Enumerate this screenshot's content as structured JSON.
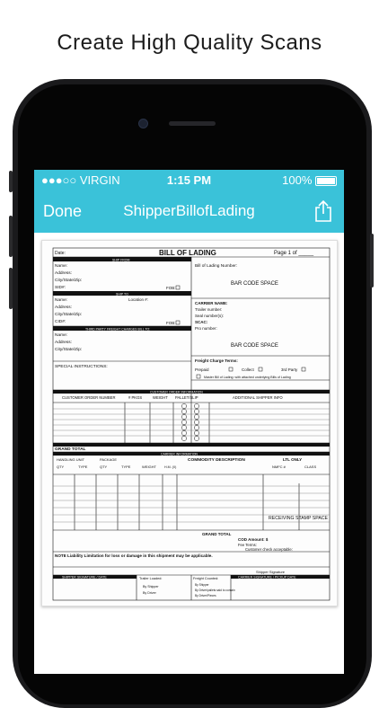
{
  "headline": "Create High Quality Scans",
  "status": {
    "carrier": "●●●○○ VIRGIN",
    "time": "1:15 PM",
    "battery": "100%"
  },
  "nav": {
    "done": "Done",
    "title": "ShipperBillofLading",
    "share_icon": "share-icon"
  },
  "accent": "#3ac2d9",
  "form": {
    "date": "Date:",
    "title": "BILL OF LADING",
    "page": "Page 1 of _____",
    "ship_from": "SHIP FROM",
    "ship_to": "SHIP TO",
    "third_party": "THIRD PARTY FREIGHT CHARGES BILL TO:",
    "name": "Name:",
    "address": "Address:",
    "city": "City/State/Zip:",
    "sid": "SID#:",
    "cid": "CID#:",
    "fob": "FOB:",
    "location": "Location #:",
    "special": "SPECIAL INSTRUCTIONS:",
    "bol_number": "Bill of Lading Number:",
    "barcode": "BAR CODE SPACE",
    "carrier_name": "CARRIER NAME:",
    "trailer": "Trailer number:",
    "seal": "Seal number(s):",
    "scac": "SCAC:",
    "pro": "Pro number:",
    "freight_terms": "Freight Charge Terms:",
    "prepaid": "Prepaid",
    "collect": "Collect",
    "third": "3rd Party",
    "master": "Master Bill of Lading: with attached underlying Bills of Lading",
    "customer_order": "CUSTOMER ORDER INFORMATION",
    "cust_order_num": "CUSTOMER ORDER NUMBER",
    "pkgs": "# PKGS",
    "weight": "WEIGHT",
    "pallet": "PALLET/SLIP",
    "addl": "ADDITIONAL SHIPPER INFO",
    "grand_total": "GRAND TOTAL",
    "carrier_info": "CARRIER INFORMATION",
    "handling_unit": "HANDLING UNIT",
    "package": "PACKAGE",
    "qty": "QTY",
    "type": "TYPE",
    "hm": "H.M. (X)",
    "commodity": "COMMODITY DESCRIPTION",
    "ltl": "LTL ONLY",
    "nmfc": "NMFC #",
    "class": "CLASS",
    "receiving": "RECEIVING STAMP SPACE",
    "cod": "COD Amount: $",
    "fee_terms": "Fee Terms:",
    "customer_check": "Customer check acceptable:",
    "note": "NOTE Liability Limitation for loss or damage in this shipment may be applicable.",
    "shipper_sig": "SHIPPER SIGNATURE / DATE",
    "trailer_loaded": "Trailer Loaded:",
    "freight_counted": "Freight Counted:",
    "carrier_sig": "CARRIER SIGNATURE / PICKUP DATE",
    "by_shipper": "By Shipper",
    "by_driver": "By Driver",
    "by_driver_pallets": "By Driver/pallets said to contain",
    "by_driver_pieces": "By Driver/Pieces",
    "shipper_signature": "Shipper Signature"
  }
}
